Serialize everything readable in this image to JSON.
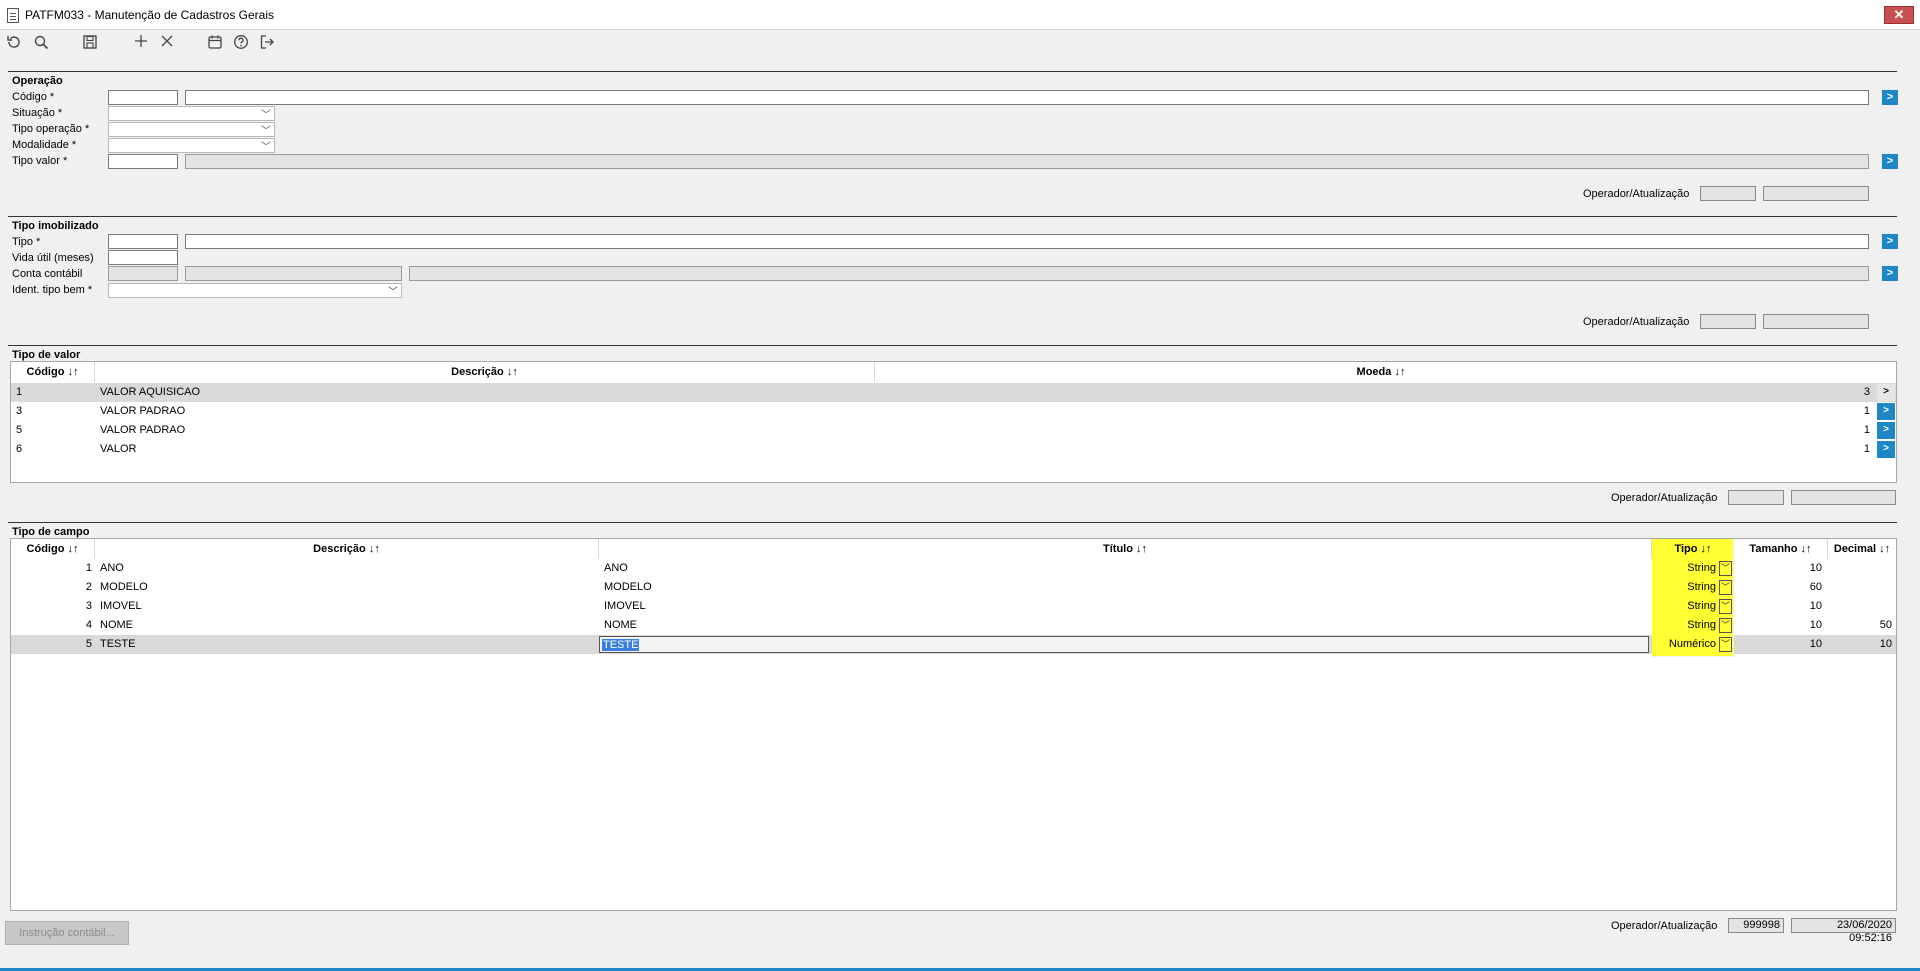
{
  "window": {
    "title": "PATFM033 - Manutenção de Cadastros Gerais",
    "close_label": "✕"
  },
  "toolbar": {
    "refresh_icon": "refresh-icon",
    "search_icon": "search-icon",
    "save_icon": "save-icon",
    "add_icon": "plus-icon",
    "delete_icon": "close-icon",
    "calendar_icon": "calendar-icon",
    "help_icon": "help-icon",
    "exit_icon": "exit-icon"
  },
  "operacao": {
    "title": "Operação",
    "codigo_label": "Código *",
    "situacao_label": "Situação *",
    "tipo_operacao_label": "Tipo operação *",
    "modalidade_label": "Modalidade *",
    "tipo_valor_label": "Tipo valor *",
    "operador_label": "Operador/Atualização"
  },
  "tipo_imobilizado": {
    "title": "Tipo imobilizado",
    "tipo_label": "Tipo *",
    "vida_util_label": "Vida útil (meses)",
    "conta_contabil_label": "Conta contábil",
    "ident_tipo_bem_label": "Ident. tipo bem *",
    "operador_label": "Operador/Atualização"
  },
  "tipo_de_valor": {
    "title": "Tipo de valor",
    "headers": {
      "codigo": "Código ↓↑",
      "descricao": "Descrição ↓↑",
      "moeda": "Moeda ↓↑"
    },
    "rows": [
      {
        "codigo": "1",
        "descricao": "VALOR AQUISICAO",
        "moeda": "3",
        "go": ">"
      },
      {
        "codigo": "3",
        "descricao": "VALOR PADRAO",
        "moeda": "1",
        "go": ">"
      },
      {
        "codigo": "5",
        "descricao": "VALOR PADRAO",
        "moeda": "1",
        "go": ">"
      },
      {
        "codigo": "6",
        "descricao": "VALOR",
        "moeda": "1",
        "go": ">"
      }
    ],
    "operador_label": "Operador/Atualização"
  },
  "tipo_de_campo": {
    "title": "Tipo de campo",
    "headers": {
      "codigo": "Código ↓↑",
      "descricao": "Descrição ↓↑",
      "titulo": "Título ↓↑",
      "tipo": "Tipo ↓↑",
      "tamanho": "Tamanho ↓↑",
      "decimal": "Decimal ↓↑"
    },
    "rows": [
      {
        "codigo": "1",
        "descricao": "ANO",
        "titulo": "ANO",
        "tipo": "String",
        "tamanho": "10",
        "decimal": ""
      },
      {
        "codigo": "2",
        "descricao": "MODELO",
        "titulo": "MODELO",
        "tipo": "String",
        "tamanho": "60",
        "decimal": ""
      },
      {
        "codigo": "3",
        "descricao": "IMOVEL",
        "titulo": "IMOVEL",
        "tipo": "String",
        "tamanho": "10",
        "decimal": ""
      },
      {
        "codigo": "4",
        "descricao": "NOME",
        "titulo": "NOME",
        "tipo": "String",
        "tamanho": "10",
        "decimal": "50"
      },
      {
        "codigo": "5",
        "descricao": "TESTE",
        "titulo": "TESTE",
        "tipo": "Numérico",
        "tamanho": "10",
        "decimal": "10"
      }
    ],
    "highlight_color": "#ffff33",
    "operador_label": "Operador/Atualização",
    "operador_value": "999998",
    "atualizacao_value": "23/06/2020 09:52:16"
  },
  "bottom": {
    "instrucao_button": "Instrução contábil..."
  },
  "colors": {
    "accent": "#1e88c7",
    "selection": "#3b7fde"
  }
}
